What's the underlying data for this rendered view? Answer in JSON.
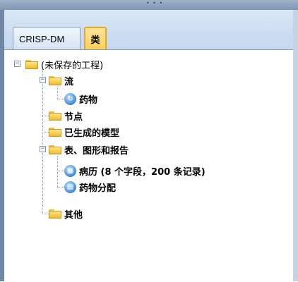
{
  "tabs": [
    {
      "label": "CRISP-DM"
    },
    {
      "label": "类"
    }
  ],
  "tree": {
    "root": "(未保存的工程)",
    "streams": "流",
    "stream_item": "药物",
    "nodes": "节点",
    "generated_models": "已生成的模型",
    "tables_graphs": "表、图形和报告",
    "table_item_1": "病历 (8 个字段，200 条记录)",
    "table_item_2": "药物分配",
    "other": "其他"
  },
  "colors": {
    "folder": "#f3b92c",
    "active_tab": "#ffcc55",
    "node_icon": "#3a8ad6"
  }
}
